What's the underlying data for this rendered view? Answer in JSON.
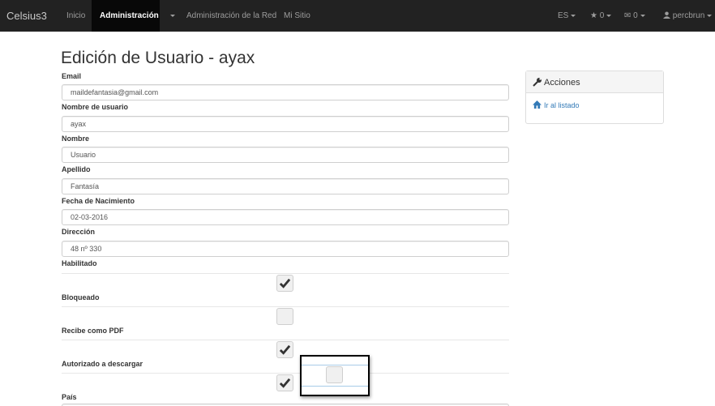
{
  "navbar": {
    "brand": "Celsius3",
    "inicio": "Inicio",
    "administracion": "Administración",
    "admin_red": "Administración de la Red",
    "mi_sitio": "Mi Sitio",
    "language": "ES",
    "favorites_count": "0",
    "messages_count": "0",
    "user": "percbrun"
  },
  "page": {
    "title": "Edición de Usuario - ayax"
  },
  "form": {
    "email": {
      "label": "Email",
      "value": "maildefantasia@gmail.com"
    },
    "username": {
      "label": "Nombre de usuario",
      "value": "ayax"
    },
    "nombre": {
      "label": "Nombre",
      "value": "Usuario"
    },
    "apellido": {
      "label": "Apellido",
      "value": "Fantasía"
    },
    "fecha": {
      "label": "Fecha de Nacimiento",
      "value": "02-03-2016"
    },
    "direccion": {
      "label": "Dirección",
      "value": "48 nº 330"
    },
    "habilitado": {
      "label": "Habilitado",
      "checked": true
    },
    "bloqueado": {
      "label": "Bloqueado",
      "checked": false
    },
    "recibe_pdf": {
      "label": "Recibe como PDF",
      "checked": true
    },
    "autorizado": {
      "label": "Autorizado a descargar",
      "checked": true
    },
    "pais": {
      "label": "País"
    }
  },
  "sidebar": {
    "title": "Acciones",
    "link": "Ir al listado"
  },
  "colors": {
    "navbar": "#222222",
    "link": "#337ab7"
  }
}
